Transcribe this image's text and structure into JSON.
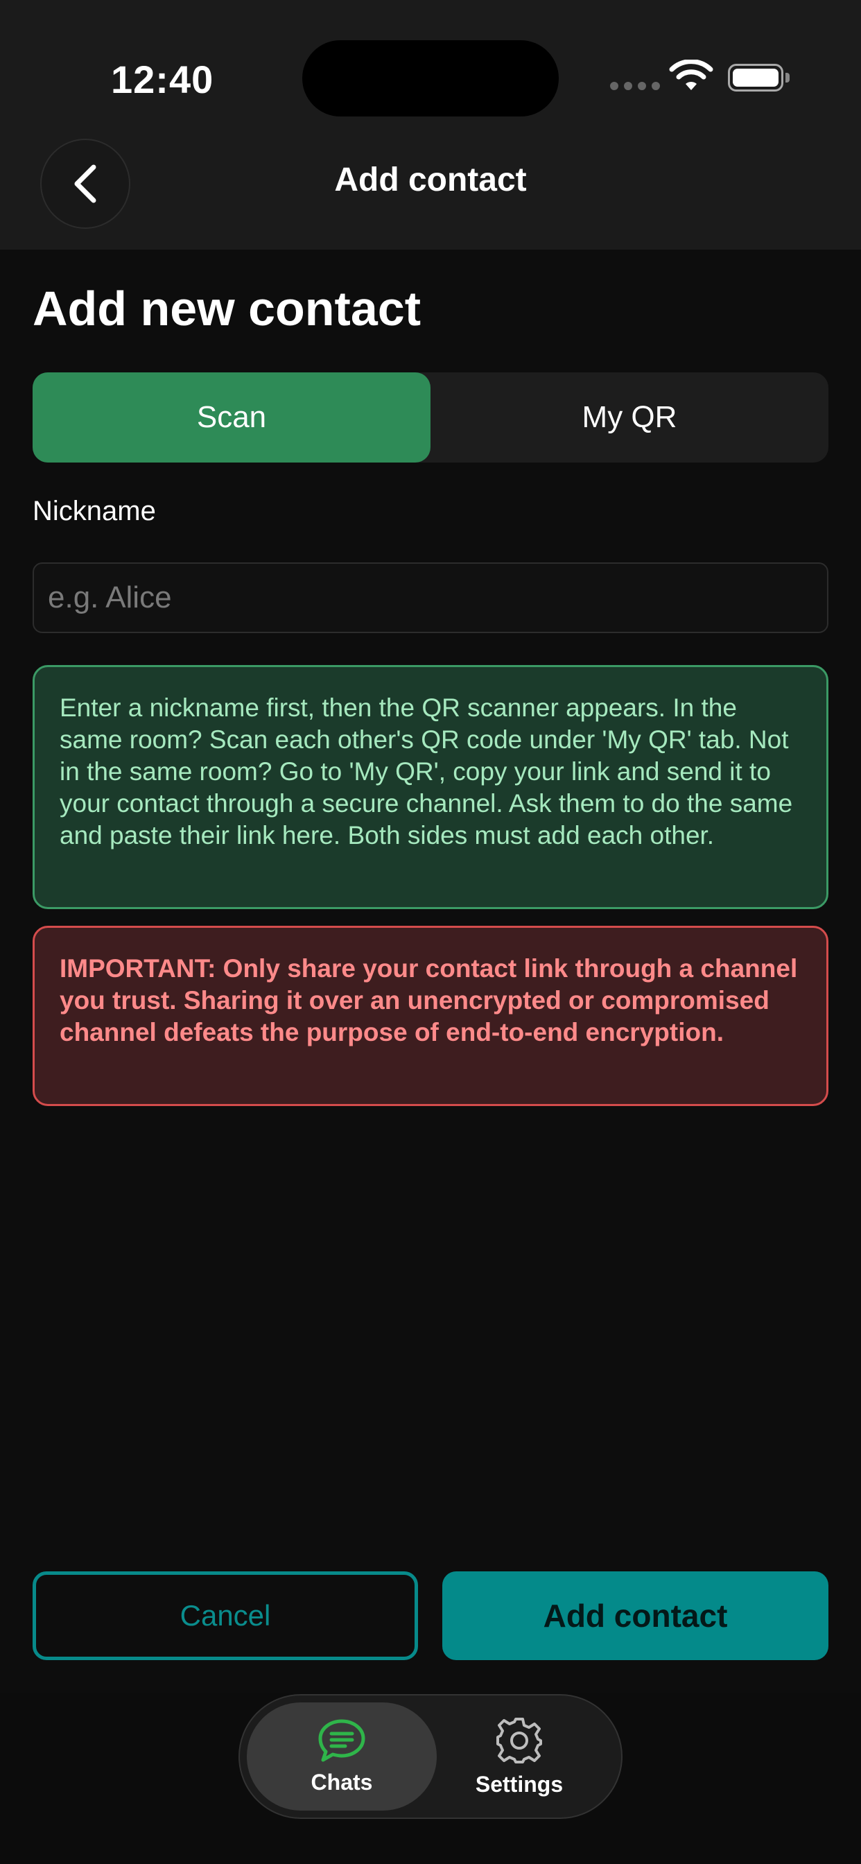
{
  "status_bar": {
    "time": "12:40"
  },
  "header": {
    "title": "Add contact",
    "back_icon": "chevron-left-icon"
  },
  "page": {
    "title": "Add new contact"
  },
  "segment": {
    "scan_label": "Scan",
    "myqr_label": "My QR",
    "selected": "Scan",
    "accent": "#2e8b57"
  },
  "nickname": {
    "label": "Nickname",
    "placeholder": "e.g. Alice",
    "value": ""
  },
  "info_box": {
    "text": "Enter a nickname first, then the QR scanner appears. In the same room? Scan each other's QR code under 'My QR' tab. Not in the same room? Go to 'My QR', copy your link and send it to your contact through a secure channel. Ask them to do the same and paste their link here. Both sides must add each other.",
    "color": "#1b3b2b"
  },
  "warning_box": {
    "text": "IMPORTANT: Only share your contact link through a channel you trust. Sharing it over an unencrypted or compromised channel defeats the purpose of end-to-end encryption.",
    "color": "#3e1d1f"
  },
  "actions": {
    "cancel_label": "Cancel",
    "add_label": "Add contact",
    "accent": "#048a8a"
  },
  "tabbar": {
    "items": [
      {
        "label": "Chats",
        "icon": "chat-bubble-icon",
        "active": true
      },
      {
        "label": "Settings",
        "icon": "gear-icon",
        "active": false
      }
    ]
  }
}
